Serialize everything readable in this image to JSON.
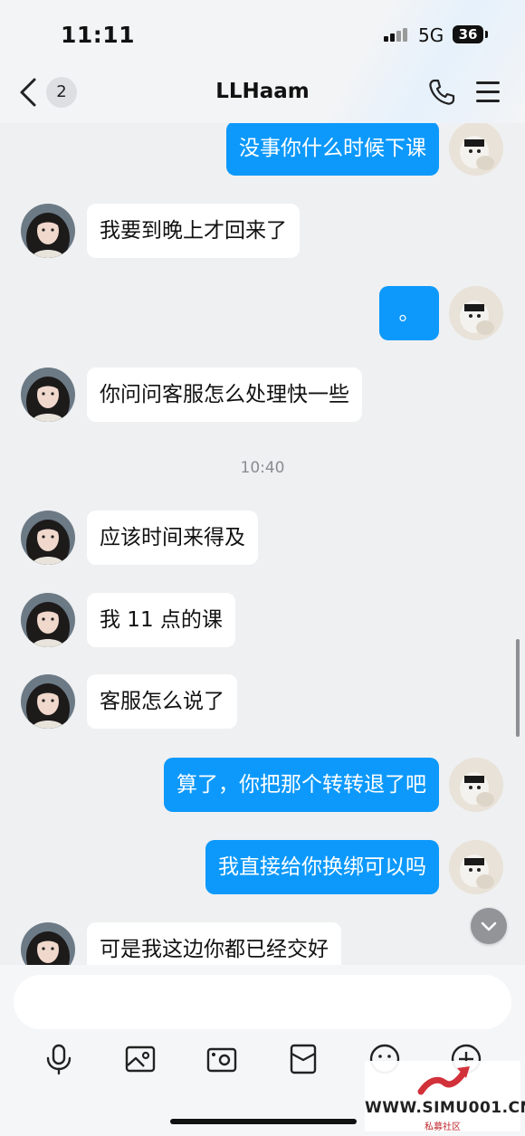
{
  "status_bar": {
    "time": "11:11",
    "network": "5G",
    "battery": "36"
  },
  "header": {
    "unread_count": "2",
    "title": "LLHaam"
  },
  "messages": [
    {
      "side": "out",
      "text": "没事你什么时候下课"
    },
    {
      "side": "in",
      "text": "我要到晚上才回来了"
    },
    {
      "side": "out",
      "text": "。"
    },
    {
      "side": "in",
      "text": "你问问客服怎么处理快一些"
    },
    {
      "side": "in",
      "text": "应该时间来得及"
    },
    {
      "side": "in",
      "text": "我 11 点的课"
    },
    {
      "side": "in",
      "text": "客服怎么说了"
    },
    {
      "side": "out",
      "text": "算了，你把那个转转退了吧"
    },
    {
      "side": "out",
      "text": "我直接给你换绑可以吗"
    },
    {
      "side": "in",
      "text": "可是我这边你都已经交好"
    }
  ],
  "timestamp": "10:40",
  "toolbar": {
    "icons": [
      "microphone-icon",
      "image-icon",
      "camera-icon",
      "red-packet-icon",
      "emoji-icon",
      "plus-icon"
    ]
  },
  "watermark": {
    "site": "WWW.SIMU001.CN",
    "label": "私募社区"
  },
  "colors": {
    "outgoing_bubble": "#0d99fb",
    "incoming_bubble": "#ffffff",
    "background": "#eff0f2"
  }
}
